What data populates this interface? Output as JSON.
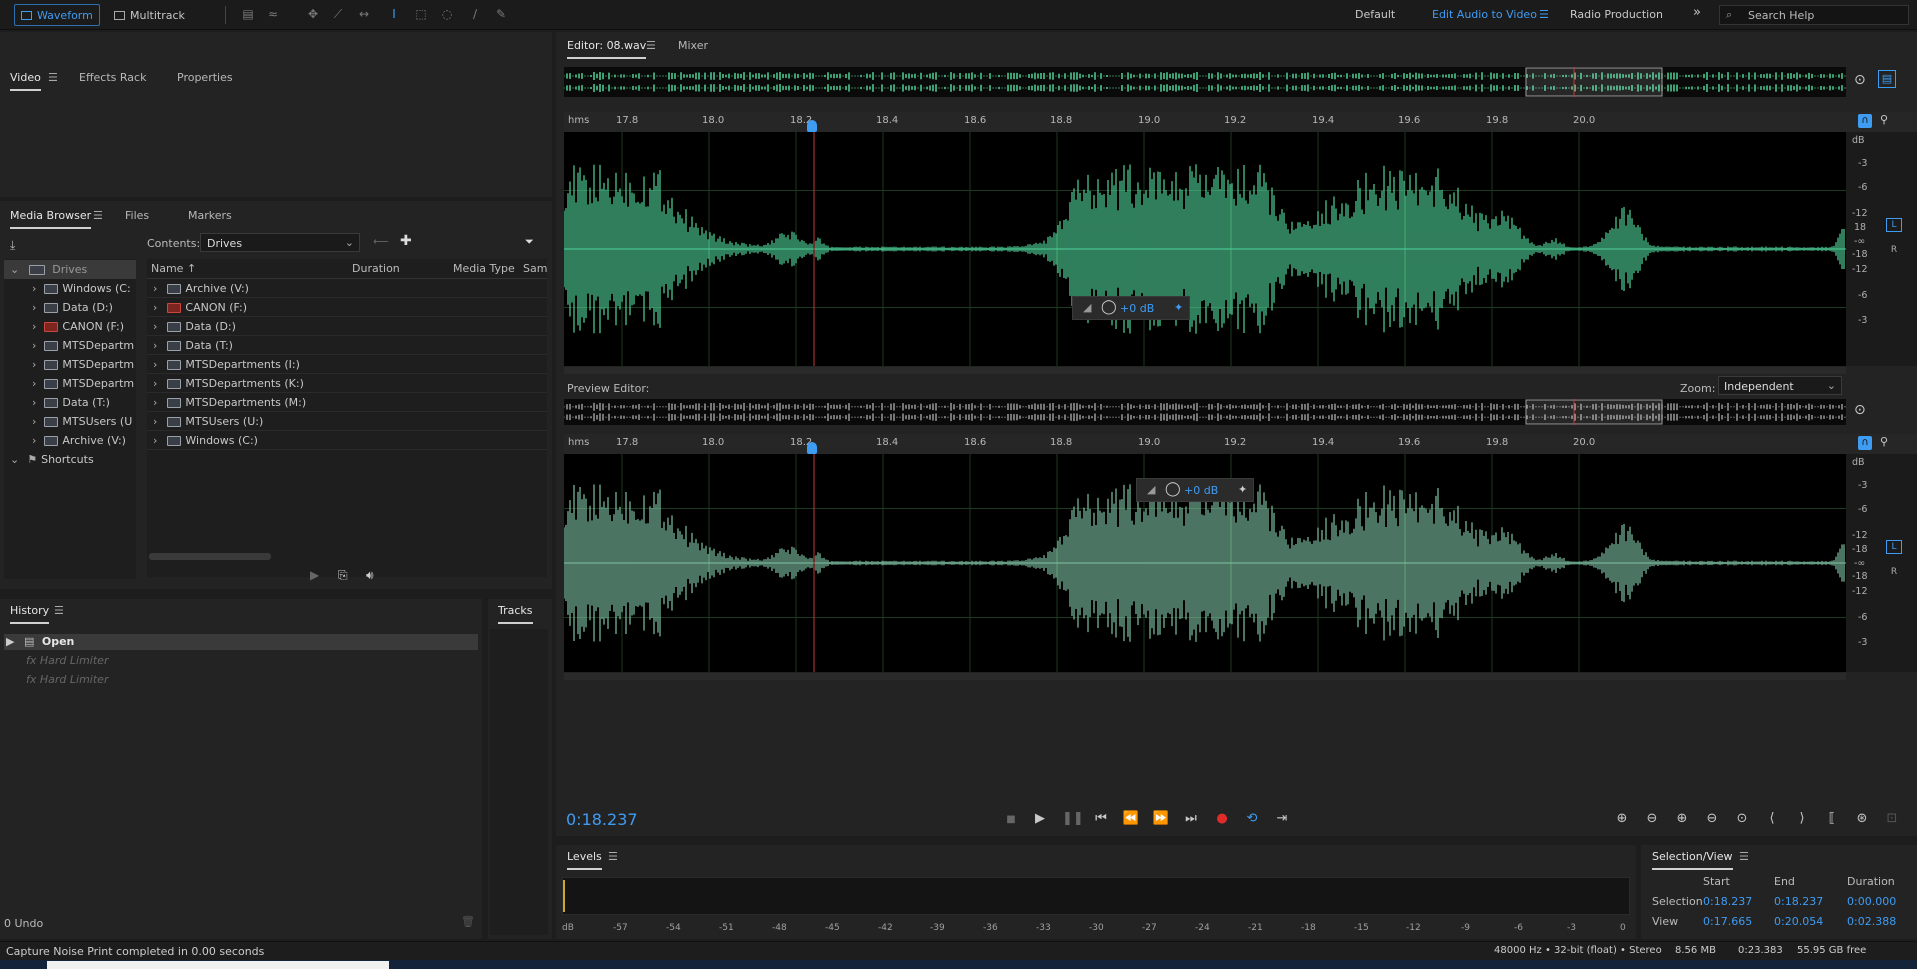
{
  "topbar": {
    "waveform": "Waveform",
    "multitrack": "Multitrack",
    "workspaces": [
      "Default",
      "Edit Audio to Video",
      "Radio Production"
    ],
    "more": "»",
    "search_placeholder": "Search Help",
    "accent": "#3f9cf3"
  },
  "left_top": {
    "tabs": [
      "Video",
      "Effects Rack",
      "Properties"
    ]
  },
  "media_browser": {
    "tabs": [
      "Media Browser",
      "Files",
      "Markers"
    ],
    "contents_label": "Contents:",
    "contents_value": "Drives",
    "tree": [
      {
        "label": "Drives",
        "level": 0
      },
      {
        "label": "Windows (C:",
        "level": 1
      },
      {
        "label": "Data (D:)",
        "level": 1
      },
      {
        "label": "CANON (F:)",
        "level": 1
      },
      {
        "label": "MTSDepartm",
        "level": 1
      },
      {
        "label": "MTSDepartm",
        "level": 1
      },
      {
        "label": "MTSDepartm",
        "level": 1
      },
      {
        "label": "Data (T:)",
        "level": 1
      },
      {
        "label": "MTSUsers (U",
        "level": 1
      },
      {
        "label": "Archive (V:)",
        "level": 1
      },
      {
        "label": "Shortcuts",
        "level": 0
      }
    ],
    "columns": [
      "Name",
      "Duration",
      "Media Type",
      "Sam"
    ],
    "files": [
      "Archive (V:)",
      "CANON (F:)",
      "Data (D:)",
      "Data (T:)",
      "MTSDepartments (I:)",
      "MTSDepartments (K:)",
      "MTSDepartments (M:)",
      "MTSUsers (U:)",
      "Windows (C:)"
    ]
  },
  "history": {
    "title": "History",
    "items": [
      "Open",
      "Hard Limiter",
      "Hard Limiter"
    ],
    "undo": "0 Undo"
  },
  "tracks": {
    "title": "Tracks"
  },
  "editor": {
    "tabs": [
      "Editor: 08.wav",
      "Mixer"
    ],
    "ruler_unit": "hms",
    "ticks": [
      "17.8",
      "18.0",
      "18.2",
      "18.4",
      "18.6",
      "18.8",
      "19.0",
      "19.2",
      "19.4",
      "19.6",
      "19.8",
      "20.0"
    ],
    "db_label": "dB",
    "db_scale": [
      "-3",
      "-6",
      "-12",
      "18",
      "-∞",
      "-18",
      "-12",
      "-6",
      "-3"
    ],
    "channels": [
      "L",
      "R"
    ],
    "hud_value": "+0 dB",
    "wave_color": "#4fd39a",
    "preview_wave_color": "#7fc1a3"
  },
  "preview": {
    "label": "Preview Editor:",
    "zoom_label": "Zoom:",
    "zoom_value": "Independent",
    "db_scale": [
      "-3",
      "-6",
      "-12",
      "-18",
      "-∞",
      "-18",
      "-12",
      "-6",
      "-3"
    ]
  },
  "transport": {
    "time": "0:18.237"
  },
  "levels": {
    "title": "Levels",
    "scale": [
      "dB",
      "-57",
      "-54",
      "-51",
      "-48",
      "-45",
      "-42",
      "-39",
      "-36",
      "-33",
      "-30",
      "-27",
      "-24",
      "-21",
      "-18",
      "-15",
      "-12",
      "-9",
      "-6",
      "-3",
      "0"
    ]
  },
  "selection_view": {
    "title": "Selection/View",
    "headers": [
      "Start",
      "End",
      "Duration"
    ],
    "rows": [
      {
        "label": "Selection",
        "start": "0:18.237",
        "end": "0:18.237",
        "duration": "0:00.000"
      },
      {
        "label": "View",
        "start": "0:17.665",
        "end": "0:20.054",
        "duration": "0:02.388"
      }
    ]
  },
  "status": {
    "message": "Capture Noise Print completed in 0.00 seconds",
    "format": "48000 Hz • 32-bit (float) • Stereo",
    "size": "8.56 MB",
    "duration": "0:23.383",
    "free": "55.95 GB free"
  }
}
